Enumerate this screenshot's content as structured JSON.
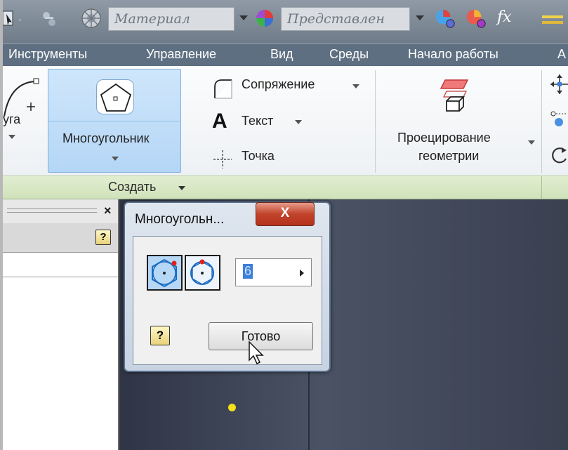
{
  "quick_access": {
    "material_placeholder": "Материал",
    "appearance_placeholder": "Представлен",
    "fx_label": "fx"
  },
  "menu": {
    "items": [
      "Инструменты",
      "Управление",
      "Вид",
      "Среды",
      "Начало работы",
      "А"
    ]
  },
  "ribbon": {
    "arc_label": "уга",
    "polygon_label": "Многоугольник",
    "fillet_label": "Сопряжение",
    "text_label": "Текст",
    "point_label": "Точка",
    "project_line1": "Проецирование",
    "project_line2": "геометрии",
    "panel_title": "Создать"
  },
  "browser": {
    "close_label": "×",
    "help_label": "?"
  },
  "dialog": {
    "title": "Многоугольн...",
    "close_label": "X",
    "sides_value": "6",
    "help_label": "?",
    "done_label": "Готово"
  },
  "colors": {
    "menubar": "#5e6f82",
    "ribbon_highlight": "#b4d6f6",
    "panel_bar": "#d5e6c2",
    "canvas": "#3f4656",
    "close_button": "#c1432a",
    "point_marker": "#f5e21a"
  }
}
